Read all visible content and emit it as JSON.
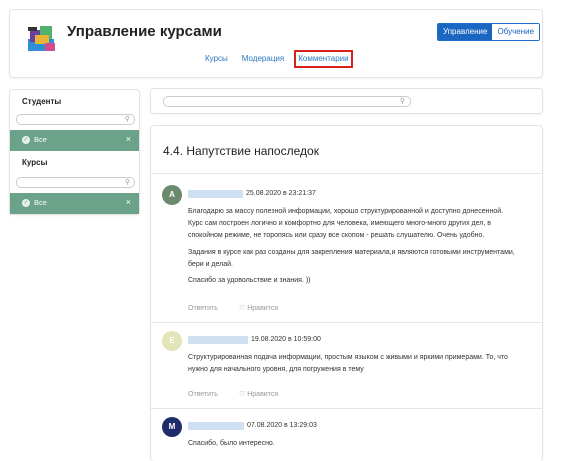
{
  "header": {
    "title": "Управление курсами",
    "roles": [
      "Управление",
      "Обучение"
    ],
    "nav": [
      "Курсы",
      "Модерация",
      "Комментарии"
    ]
  },
  "sidebar": {
    "students_heading": "Студенты",
    "students_filter": "Все",
    "courses_heading": "Курсы",
    "courses_filter": "Все",
    "close_glyph": "×"
  },
  "lesson": {
    "title": "4.4. Напутствие напоследок"
  },
  "comments": [
    {
      "avatar_letter": "A",
      "avatar_color": "#6b8a6d",
      "date": "25.08.2020 в 23:21:37",
      "paragraphs": [
        "Благодарю за массу полезной информации, хорошо структурированной и доступно донесенной. Курс сам построен логично и комфортно для человека, имеющего много-много других дел, в спокойном режиме, не торопясь или сразу все скопом - решать слушателю. Очень удобно.",
        "Задания в курсе как раз созданы для закрепления материала,и являются готовыми инструментами, бери и делай.",
        "Спасибо за удовольствие и знания. ))"
      ],
      "reply": "Ответить",
      "like": "Нравится"
    },
    {
      "avatar_letter": "E",
      "avatar_color": "#e3e4b8",
      "date": "19.08.2020 в 10:59:00",
      "paragraphs": [
        "Структурированная подача информации, простым языком с живыми и яркими примерами. То, что нужно для начального уровня, для погружения в тему"
      ],
      "reply": "Ответить",
      "like": "Нравится"
    },
    {
      "avatar_letter": "M",
      "avatar_color": "#1f2c6b",
      "date": "07.08.2020 в 13:29:03",
      "paragraphs": [
        "Спасибо, было интересно."
      ]
    }
  ]
}
